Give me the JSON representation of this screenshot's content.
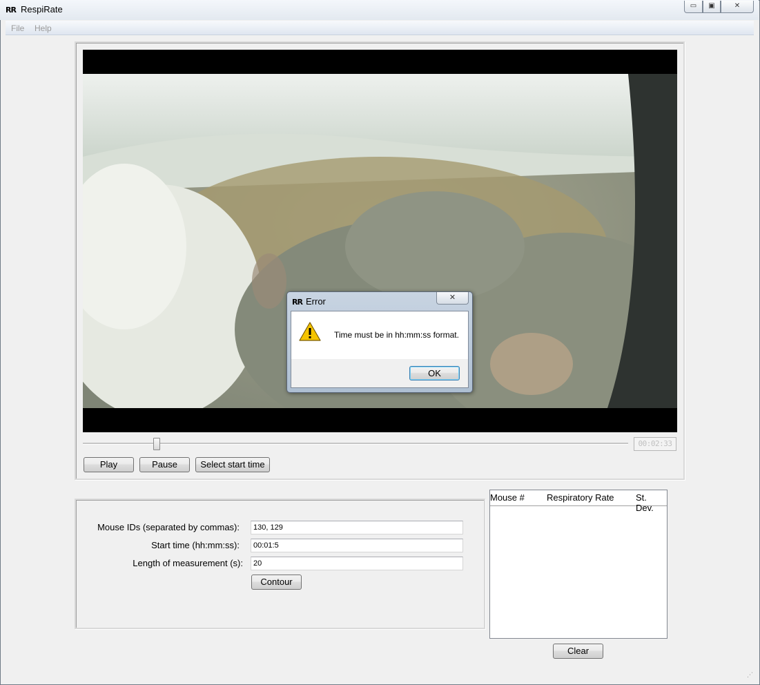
{
  "window": {
    "title": "RespiRate",
    "logo_text": "RR"
  },
  "titlebar_buttons": {
    "minimize": "▭",
    "maximize": "▣",
    "close": "✕"
  },
  "menu": {
    "file": "File",
    "help": "Help"
  },
  "video": {
    "time_display": "00:02:33",
    "seek_position": 0.135
  },
  "controls": {
    "play": "Play",
    "pause": "Pause",
    "select_start": "Select start time"
  },
  "form": {
    "mouse_ids_label": "Mouse IDs (separated by commas):",
    "mouse_ids_value": "130, 129",
    "start_time_label": "Start time (hh:mm:ss):",
    "start_time_value": "00:01:5",
    "length_label": "Length of measurement (s):",
    "length_value": "20",
    "contour_label": "Contour"
  },
  "results": {
    "columns": [
      "Mouse #",
      "Respiratory Rate",
      "St. Dev."
    ],
    "rows": [],
    "clear_label": "Clear"
  },
  "dialog": {
    "title": "Error",
    "logo_text": "RR",
    "message": "Time must be in hh:mm:ss format.",
    "ok_label": "OK",
    "close_glyph": "✕",
    "icon": "warning-icon"
  },
  "resize_grip": "⋰"
}
